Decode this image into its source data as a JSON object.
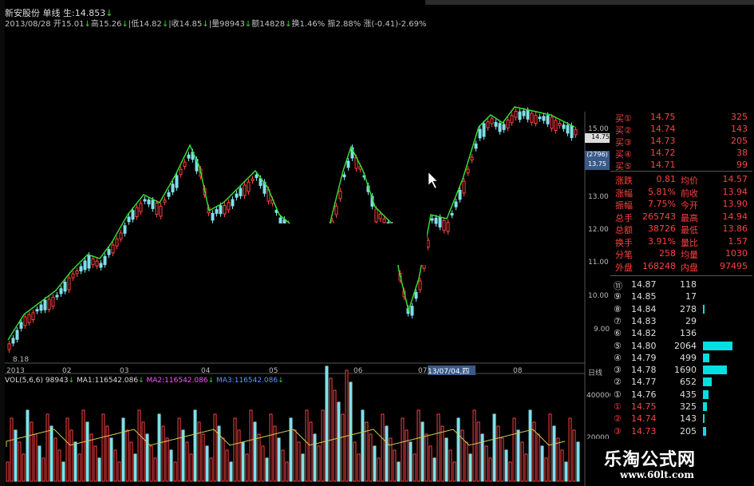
{
  "title": {
    "name": "新安股份",
    "period": "单线",
    "sheng_label": "生:",
    "sheng_value": "14.853"
  },
  "quote": {
    "date": "2013/08/28",
    "open_label": "开",
    "open": "15.01",
    "high_label": "高",
    "high": "15.26",
    "low_label": "低",
    "low": "14.82",
    "close_label": "收",
    "close": "14.85",
    "volume_label": "量",
    "volume": "98943",
    "amount_label": "额",
    "amount": "14828",
    "turnover_label": "换",
    "turnover": "1.46%",
    "amplitude_label": "振",
    "amplitude": "2.88%",
    "change_label": "涨",
    "change": "(-0.41)-2.69%"
  },
  "price_axis": [
    "15.00",
    "14.00",
    "13.00",
    "12.00",
    "11.00",
    "10.00",
    "9.00"
  ],
  "price_tags": {
    "current": "14.75",
    "tag2": "(2796)",
    "tag3": "13.75"
  },
  "low_marker": "8.18",
  "date_axis": [
    "2013",
    "02",
    "03",
    "04",
    "05",
    "06",
    "07",
    "08"
  ],
  "date_tip": "13/07/04,四",
  "period_label": "日线",
  "volume": {
    "header": "VOL(5,6,6)",
    "vol": "98943",
    "ma1_label": "MA1:",
    "ma1": "116542.086",
    "ma2_label": "MA2:",
    "ma2": "116542.086",
    "ma3_label": "MA3:",
    "ma3": "116542.086",
    "axis_top": "400000",
    "axis_bottom": "20000"
  },
  "buy_orders": [
    {
      "label": "买①",
      "price": "14.75",
      "qty": "325"
    },
    {
      "label": "买②",
      "price": "14.74",
      "qty": "143"
    },
    {
      "label": "买③",
      "price": "14.73",
      "qty": "205"
    },
    {
      "label": "买④",
      "price": "14.72",
      "qty": "38"
    },
    {
      "label": "买⑤",
      "price": "14.71",
      "qty": "99"
    }
  ],
  "stats": [
    {
      "k1": "涨跌",
      "v1": "0.81",
      "k2": "均价",
      "v2": "14.57"
    },
    {
      "k1": "涨幅",
      "v1": "5.81%",
      "k2": "前收",
      "v2": "13.94"
    },
    {
      "k1": "振幅",
      "v1": "7.75%",
      "k2": "今开",
      "v2": "13.90"
    },
    {
      "k1": "总手",
      "v1": "265743",
      "k2": "最高",
      "v2": "14.94"
    },
    {
      "k1": "总额",
      "v1": "38726",
      "k2": "最低",
      "v2": "13.86"
    },
    {
      "k1": "换手",
      "v1": "3.91%",
      "k2": "量比",
      "v2": "1.57"
    },
    {
      "k1": "分笔",
      "v1": "258",
      "k2": "均量",
      "v2": "1030"
    },
    {
      "k1": "外盘",
      "v1": "168248",
      "k2": "内盘",
      "v2": "97495"
    }
  ],
  "depth": [
    {
      "label": "⑪",
      "price": "14.87",
      "qty": "118",
      "bar": 0
    },
    {
      "label": "⑨",
      "price": "14.85",
      "qty": "17",
      "bar": 0
    },
    {
      "label": "⑧",
      "price": "14.84",
      "qty": "278",
      "bar": 0.03
    },
    {
      "label": "⑦",
      "price": "14.83",
      "qty": "29",
      "bar": 0
    },
    {
      "label": "⑥",
      "price": "14.82",
      "qty": "136",
      "bar": 0
    },
    {
      "label": "⑤",
      "price": "14.80",
      "qty": "2064",
      "bar": 0.62
    },
    {
      "label": "④",
      "price": "14.79",
      "qty": "499",
      "bar": 0.14
    },
    {
      "label": "③",
      "price": "14.78",
      "qty": "1690",
      "bar": 0.5
    },
    {
      "label": "②",
      "price": "14.77",
      "qty": "652",
      "bar": 0.19
    },
    {
      "label": "①",
      "price": "14.76",
      "qty": "435",
      "bar": 0.12
    },
    {
      "label": "①",
      "price": "14.75",
      "qty": "325",
      "bar": 0.09
    },
    {
      "label": "②",
      "price": "14.74",
      "qty": "143",
      "bar": 0.03
    },
    {
      "label": "③",
      "price": "14.73",
      "qty": "205",
      "bar": 0.06
    }
  ],
  "watermark": {
    "title": "乐淘公式网",
    "url": "www.60lt.com"
  },
  "colors": {
    "up": "#ff4040",
    "down": "#7fe0e8",
    "ma": "#33dd33",
    "accent": "#00e0e0"
  }
}
